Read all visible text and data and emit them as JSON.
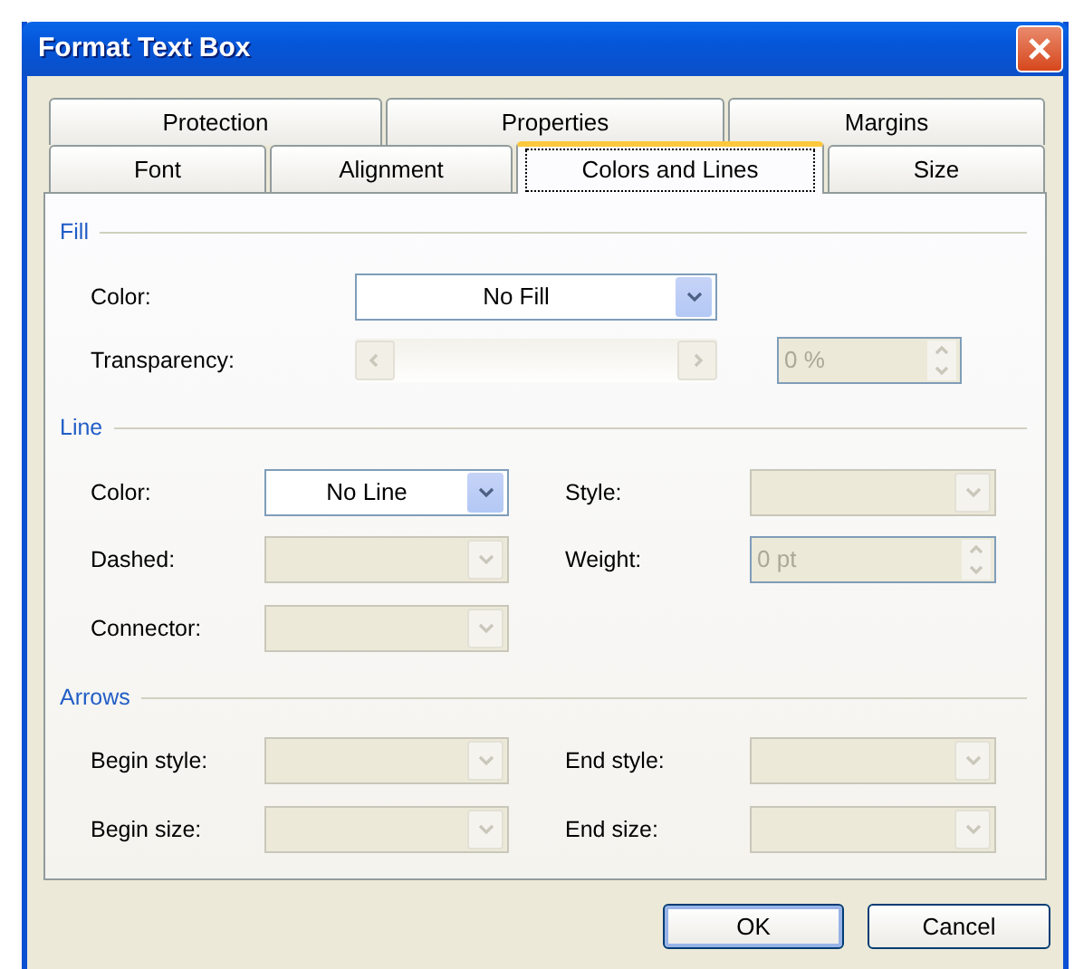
{
  "window": {
    "title": "Format Text Box"
  },
  "tab_rows": [
    {
      "tabs": [
        {
          "label": "Protection",
          "selected": false
        },
        {
          "label": "Properties",
          "selected": false
        },
        {
          "label": "Margins",
          "selected": false
        }
      ]
    },
    {
      "tabs": [
        {
          "label": "Font",
          "selected": false
        },
        {
          "label": "Alignment",
          "selected": false
        },
        {
          "label": "Colors and Lines",
          "selected": true
        },
        {
          "label": "Size",
          "selected": false
        }
      ]
    }
  ],
  "sections": [
    {
      "title": "Fill",
      "kind": "wide",
      "rows": [
        {
          "fields": [
            {
              "kind": "dropdown",
              "label": "Color:",
              "value": "No Fill",
              "disabled": false
            }
          ]
        },
        {
          "fields": [
            {
              "kind": "slider",
              "label": "Transparency:",
              "disabled": true
            },
            {
              "kind": "spinner",
              "value": "0 %",
              "disabled": true
            }
          ]
        }
      ]
    },
    {
      "title": "Line",
      "kind": "pairs",
      "rows": [
        {
          "fields": [
            {
              "kind": "dropdown",
              "label": "Color:",
              "value": "No Line",
              "disabled": false
            },
            {
              "kind": "dropdown",
              "label": "Style:",
              "disabled": true
            }
          ]
        },
        {
          "fields": [
            {
              "kind": "dropdown",
              "label": "Dashed:",
              "disabled": true
            },
            {
              "kind": "spinner",
              "label": "Weight:",
              "value": "0 pt",
              "disabled": true
            }
          ]
        },
        {
          "fields": [
            {
              "kind": "dropdown",
              "label": "Connector:",
              "disabled": true
            }
          ]
        }
      ]
    },
    {
      "title": "Arrows",
      "kind": "pairs",
      "rows": [
        {
          "fields": [
            {
              "kind": "dropdown",
              "label": "Begin style:",
              "disabled": true
            },
            {
              "kind": "dropdown",
              "label": "End style:",
              "disabled": true
            }
          ]
        },
        {
          "fields": [
            {
              "kind": "dropdown",
              "label": "Begin size:",
              "disabled": true
            },
            {
              "kind": "dropdown",
              "label": "End size:",
              "disabled": true
            }
          ]
        }
      ]
    }
  ],
  "buttons": [
    {
      "label": "OK",
      "default": true
    },
    {
      "label": "Cancel",
      "default": false
    }
  ]
}
